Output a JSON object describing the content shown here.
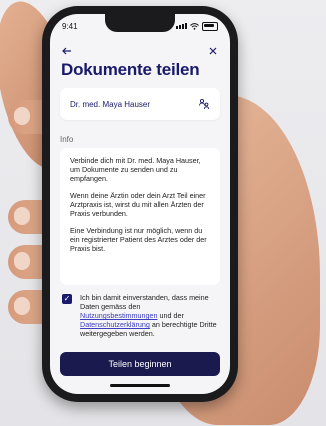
{
  "status_bar": {
    "time": "9:41"
  },
  "nav": {
    "back_icon": "arrow-left-icon",
    "close_icon": "close-icon"
  },
  "title": "Dokumente teilen",
  "doctor_card": {
    "name": "Dr. med. Maya Hauser",
    "icon": "user-switch-icon"
  },
  "info": {
    "label": "Info",
    "paragraphs": [
      "Verbinde dich mit Dr. med. Maya Hauser, um Dokumente zu senden und zu empfangen.",
      "Wenn deine Ärztin oder dein Arzt Teil einer Arztpraxis ist, wirst du mit allen Ärzten der Praxis verbunden.",
      "Eine Verbindung ist nur möglich, wenn du ein registrierter Patient des Arztes oder der Praxis bist."
    ]
  },
  "consent": {
    "checked": true,
    "text_1": "Ich bin damit einverstanden, dass meine Daten gemäss den ",
    "link_1": "Nutzungsbestimmungen",
    "text_2": " und der ",
    "link_2": "Datenschutzerklärung",
    "text_3": " an berechtigte Dritte weitergegeben werden."
  },
  "cta": {
    "label": "Teilen beginnen"
  },
  "colors": {
    "primary": "#1a1a6b",
    "button": "#1a1a4e",
    "link": "#3d3dbf"
  }
}
